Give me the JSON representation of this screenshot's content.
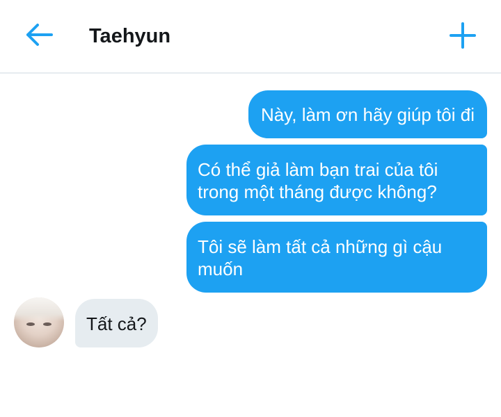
{
  "header": {
    "title": "Taehyun",
    "back_icon": "arrow-left-icon",
    "add_icon": "plus-icon",
    "accent_color": "#1da1f2"
  },
  "messages": [
    {
      "direction": "sent",
      "text": "Này, làm ơn hãy giúp tôi đi"
    },
    {
      "direction": "sent",
      "text": "Có thể giả làm bạn trai của tôi trong một tháng được không?"
    },
    {
      "direction": "sent",
      "text": "Tôi sẽ làm tất cả những gì cậu muốn"
    },
    {
      "direction": "received",
      "text": "Tất cả?"
    }
  ],
  "colors": {
    "sent_bubble": "#1da1f2",
    "received_bubble": "#e6ecf0",
    "divider": "#e6ecf0"
  }
}
